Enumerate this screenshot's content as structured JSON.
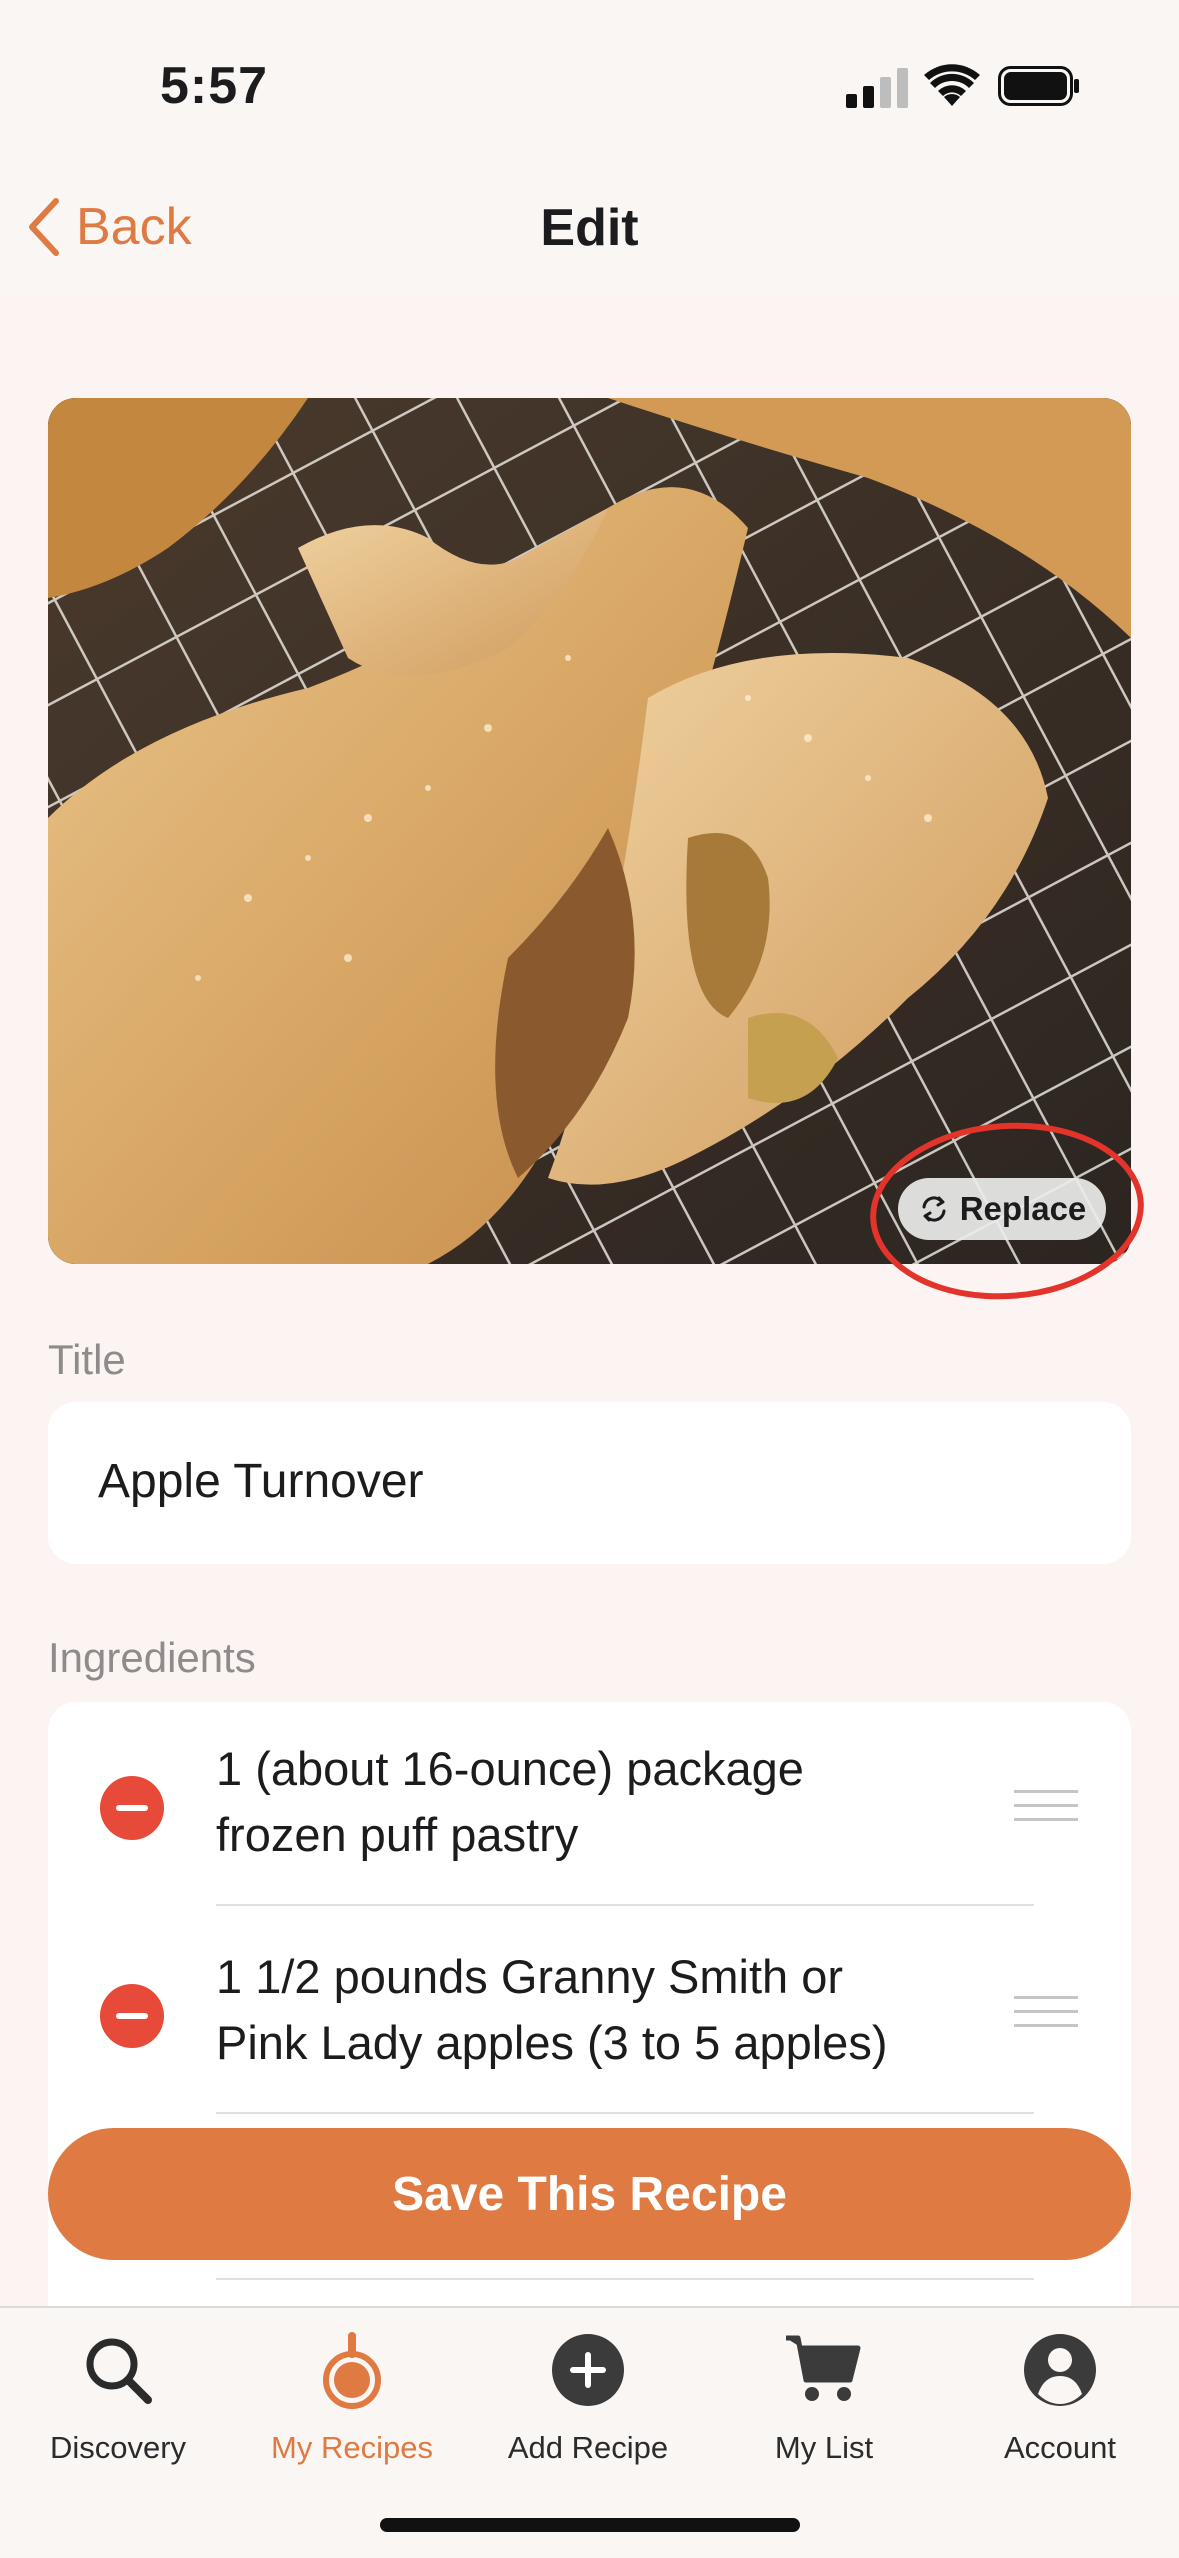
{
  "status_bar": {
    "time": "5:57"
  },
  "nav": {
    "back_label": "Back",
    "title": "Edit"
  },
  "photo": {
    "replace_label": "Replace",
    "annotation_color": "#e2342b"
  },
  "title_section": {
    "label": "Title",
    "value": "Apple Turnover"
  },
  "ingredients_section": {
    "label": "Ingredients",
    "items": [
      {
        "line1": "1 (about 16-ounce) package",
        "line2": "frozen puff pastry"
      },
      {
        "line1": "1 1/2 pounds Granny Smith or",
        "line2": "Pink Lady apples (3 to 5 apples)"
      }
    ]
  },
  "save_button": {
    "label": "Save This Recipe"
  },
  "tabs": [
    {
      "label": "Discovery",
      "icon": "magnifier-icon"
    },
    {
      "label": "My Recipes",
      "icon": "pan-icon"
    },
    {
      "label": "Add Recipe",
      "icon": "plus-circle-icon"
    },
    {
      "label": "My List",
      "icon": "cart-icon"
    },
    {
      "label": "Account",
      "icon": "person-icon"
    }
  ],
  "colors": {
    "accent": "#de7a42",
    "remove": "#e84a3a",
    "background": "#fbf4f2"
  }
}
